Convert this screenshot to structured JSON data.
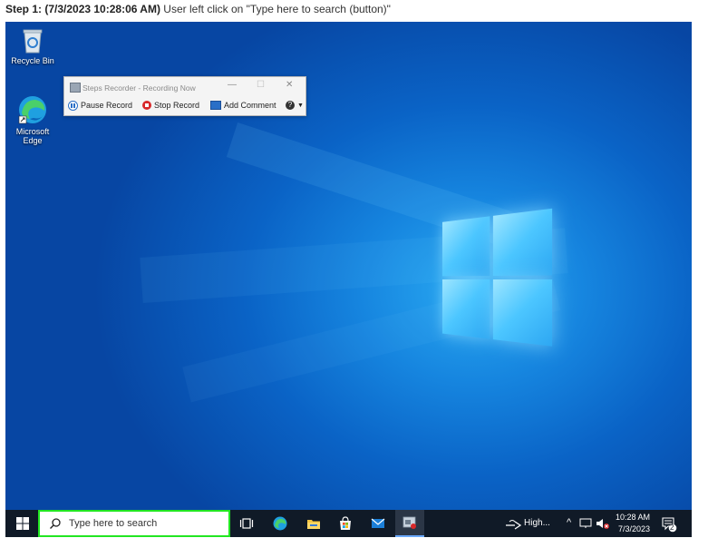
{
  "caption": {
    "step": "Step 1: (7/3/2023 10:28:06 AM)",
    "text": " User left click on \"Type here to search (button)\""
  },
  "desktop": {
    "icons": [
      {
        "label": "Recycle Bin",
        "icon": "recycle-bin-icon"
      },
      {
        "label_line1": "Microsoft",
        "label_line2": "Edge",
        "icon": "edge-icon"
      }
    ]
  },
  "steps_recorder": {
    "title": "Steps Recorder - Recording Now",
    "minimize": "—",
    "close": "✕",
    "pause": "Pause Record",
    "stop": "Stop Record",
    "add_comment": "Add Comment",
    "help": "?"
  },
  "taskbar": {
    "search_placeholder": "Type here to search",
    "network_label": "High...",
    "time": "10:28 AM",
    "date": "7/3/2023",
    "notification_count": "2"
  },
  "colors": {
    "highlight": "#22e622",
    "taskbar": "#101a27"
  }
}
